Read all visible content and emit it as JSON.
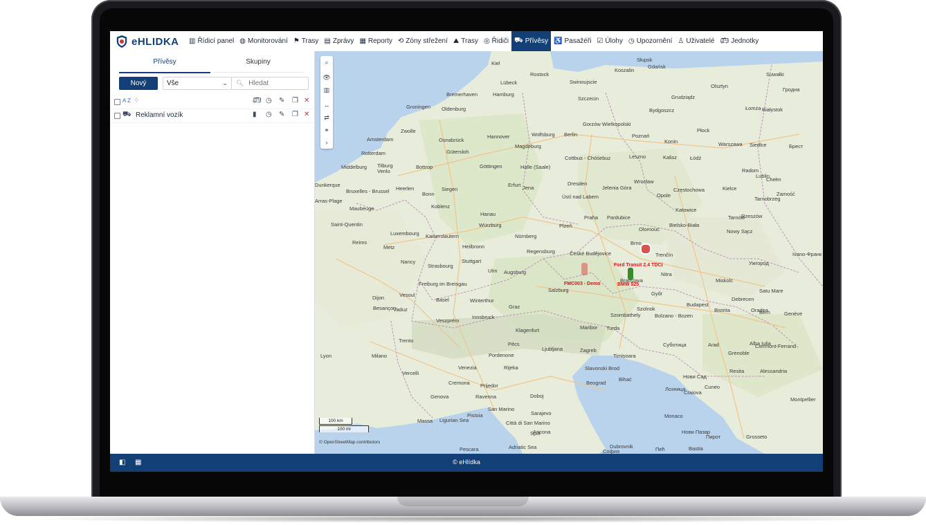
{
  "app": {
    "logo_text": "eHLIDKA",
    "footer_copyright": "© eHlídka"
  },
  "nav": [
    {
      "label": "Řídicí panel",
      "icon": "bar-chart-icon"
    },
    {
      "label": "Monitorování",
      "icon": "globe-icon"
    },
    {
      "label": "Trasy",
      "icon": "flag-icon"
    },
    {
      "label": "Zprávy",
      "icon": "message-icon"
    },
    {
      "label": "Reporty",
      "icon": "report-icon"
    },
    {
      "label": "Zóny střežení",
      "icon": "zone-icon"
    },
    {
      "label": "Trasy",
      "icon": "route-icon"
    },
    {
      "label": "Řidiči",
      "icon": "steering-wheel-icon"
    },
    {
      "label": "Přívěsy",
      "icon": "trailer-icon",
      "active": true
    },
    {
      "label": "Pasažéři",
      "icon": "passenger-icon"
    },
    {
      "label": "Úlohy",
      "icon": "task-icon"
    },
    {
      "label": "Upozornění",
      "icon": "alarm-icon"
    },
    {
      "label": "Uživatelé",
      "icon": "users-icon"
    },
    {
      "label": "Jednotky",
      "icon": "bus-icon"
    }
  ],
  "panel": {
    "tabs": [
      "Přívěsy",
      "Skupiny"
    ],
    "new_button": "Nový",
    "filter_value": "Vše",
    "search_placeholder": "Hledat",
    "sort_label": "A Z",
    "items": [
      {
        "name": "Reklamní vozík"
      }
    ]
  },
  "map": {
    "cities": [
      {
        "name": "Kiel"
      },
      {
        "name": "Rostock"
      },
      {
        "name": "Lübeck"
      },
      {
        "name": "Swinoujscie"
      },
      {
        "name": "Słupsk"
      },
      {
        "name": "Gdańsk"
      },
      {
        "name": "Koszalin"
      },
      {
        "name": "Bremerhaven"
      },
      {
        "name": "Hamburg"
      },
      {
        "name": "Szczecin"
      },
      {
        "name": "Suwałki"
      },
      {
        "name": "Olsztyn"
      },
      {
        "name": "Гродна"
      },
      {
        "name": "Groningen"
      },
      {
        "name": "Oldenburg"
      },
      {
        "name": "Grudziądz"
      },
      {
        "name": "Bydgoszcz"
      },
      {
        "name": "Łomża"
      },
      {
        "name": "Białystok"
      },
      {
        "name": "Berlin"
      },
      {
        "name": "Gorzów Wielkopolski"
      },
      {
        "name": "Zwolle"
      },
      {
        "name": "Osnabrück"
      },
      {
        "name": "Hannover"
      },
      {
        "name": "Wolfsburg"
      },
      {
        "name": "Poznań"
      },
      {
        "name": "Płock"
      },
      {
        "name": "Amsterdam"
      },
      {
        "name": "Magdeburg"
      },
      {
        "name": "Konin"
      },
      {
        "name": "Warszawa"
      },
      {
        "name": "Siedlce"
      },
      {
        "name": "Брест"
      },
      {
        "name": "Rotterdam"
      },
      {
        "name": "Gütersloh"
      },
      {
        "name": "Cottbus - Chóśebuz"
      },
      {
        "name": "Leszno"
      },
      {
        "name": "Kalisz"
      },
      {
        "name": "Łódź"
      },
      {
        "name": "Middelburg"
      },
      {
        "name": "Tilburg"
      },
      {
        "name": "Bottrop"
      },
      {
        "name": "Göttingen"
      },
      {
        "name": "Halle (Saale)"
      },
      {
        "name": "Radom"
      },
      {
        "name": "Venlo"
      },
      {
        "name": "Lublin"
      },
      {
        "name": "Chełm"
      },
      {
        "name": "Dunkerque"
      },
      {
        "name": "Heerlen"
      },
      {
        "name": "Erfurt"
      },
      {
        "name": "Dresden"
      },
      {
        "name": "Wrocław"
      },
      {
        "name": "Bruxelles - Brussel"
      },
      {
        "name": "Siegen"
      },
      {
        "name": "Jena"
      },
      {
        "name": "Jelenia Góra"
      },
      {
        "name": "Częstochowa"
      },
      {
        "name": "Kielce"
      },
      {
        "name": "Bonn"
      },
      {
        "name": "Ústí nad Labem"
      },
      {
        "name": "Opole"
      },
      {
        "name": "Tarnobrzeg"
      },
      {
        "name": "Zamość"
      },
      {
        "name": "Arras-Plage"
      },
      {
        "name": "Maubeuge"
      },
      {
        "name": "Koblenz"
      },
      {
        "name": "Katowice"
      },
      {
        "name": "Praha"
      },
      {
        "name": "Pardubice"
      },
      {
        "name": "Hanau"
      },
      {
        "name": "Tarnów"
      },
      {
        "name": "Rzeszów"
      },
      {
        "name": "Saint-Quentin"
      },
      {
        "name": "Würzburg"
      },
      {
        "name": "Plzeň"
      },
      {
        "name": "Olomouc"
      },
      {
        "name": "Bielsko-Biała"
      },
      {
        "name": "Luxembourg"
      },
      {
        "name": "Kaiserslautern"
      },
      {
        "name": "Nürnberg"
      },
      {
        "name": "Nowy Sącz"
      },
      {
        "name": "Reims"
      },
      {
        "name": "Metz"
      },
      {
        "name": "Heilbronn"
      },
      {
        "name": "Regensburg"
      },
      {
        "name": "České Budějovice"
      },
      {
        "name": "Brno"
      },
      {
        "name": "Trenčín"
      },
      {
        "name": "Nancy"
      },
      {
        "name": "Strasbourg"
      },
      {
        "name": "Stuttgart"
      },
      {
        "name": "Ivano-Франк"
      },
      {
        "name": "Ужгород"
      },
      {
        "name": "Ulm"
      },
      {
        "name": "Augsburg"
      },
      {
        "name": "Nitra"
      },
      {
        "name": "Freiburg im Breisgau"
      },
      {
        "name": "Salzburg"
      },
      {
        "name": "Bratislava"
      },
      {
        "name": "Miskolc"
      },
      {
        "name": "Satu Mare"
      },
      {
        "name": "Dijon"
      },
      {
        "name": "Vesoul"
      },
      {
        "name": "Basel"
      },
      {
        "name": "Winterthur"
      },
      {
        "name": "Győr"
      },
      {
        "name": "Budapest"
      },
      {
        "name": "Debrecen"
      },
      {
        "name": "Oradea"
      },
      {
        "name": "Besançon"
      },
      {
        "name": "Vaduz"
      },
      {
        "name": "Innsbruck"
      },
      {
        "name": "Graz"
      },
      {
        "name": "Szombathely"
      },
      {
        "name": "Szolnok"
      },
      {
        "name": "Bistrita"
      },
      {
        "name": "Bern"
      },
      {
        "name": "Veszprém"
      },
      {
        "name": "Bolzano - Bozen"
      },
      {
        "name": "Klagenfurt"
      },
      {
        "name": "Maribor"
      },
      {
        "name": "Turda"
      },
      {
        "name": "Genève"
      },
      {
        "name": "Trento"
      },
      {
        "name": "Pécs"
      },
      {
        "name": "Суботица"
      },
      {
        "name": "Arad"
      },
      {
        "name": "Alba Iulia"
      },
      {
        "name": "Clermont-Ferrand"
      },
      {
        "name": "Lyon"
      },
      {
        "name": "Milano"
      },
      {
        "name": "Pordenone"
      },
      {
        "name": "Ljubljana"
      },
      {
        "name": "Zagreb"
      },
      {
        "name": "Timișoara"
      },
      {
        "name": "Grenoble"
      },
      {
        "name": "Vercelli"
      },
      {
        "name": "Venezia"
      },
      {
        "name": "Rijeka"
      },
      {
        "name": "Slavonski Brod"
      },
      {
        "name": "Нови Сад"
      },
      {
        "name": "Resita"
      },
      {
        "name": "Alessandria"
      },
      {
        "name": "Cremona"
      },
      {
        "name": "Prijedor"
      },
      {
        "name": "Bihać"
      },
      {
        "name": "Beograd"
      },
      {
        "name": "Cuneo"
      },
      {
        "name": "Genova"
      },
      {
        "name": "Ravenna"
      },
      {
        "name": "Doboj"
      },
      {
        "name": "Лозница"
      },
      {
        "name": "Craiova"
      },
      {
        "name": "Montpellier"
      },
      {
        "name": "Massa"
      },
      {
        "name": "San Marino"
      },
      {
        "name": "Sarajevo"
      },
      {
        "name": "Monaco"
      },
      {
        "name": "Ligurian Sea"
      },
      {
        "name": "Pistoia"
      },
      {
        "name": "Città di San Marino"
      },
      {
        "name": "Ancona"
      },
      {
        "name": "Split"
      },
      {
        "name": "Нови Пазар"
      },
      {
        "name": "Пирот"
      },
      {
        "name": "Grosseto"
      },
      {
        "name": "Adriatic Sea"
      },
      {
        "name": "Dubrovnik"
      },
      {
        "name": "Пећ"
      },
      {
        "name": "Bastia"
      },
      {
        "name": "Pescara"
      },
      {
        "name": "София"
      }
    ],
    "markers": [
      {
        "label": "FMC003 - Demo",
        "color": "#d9534f"
      },
      {
        "label": "BMW 525",
        "color": "#3a8a2e"
      },
      {
        "label": "Ford Transit 2.4 TDCi",
        "color": "#d9534f"
      }
    ],
    "scale_km": "100 km",
    "scale_mi": "100 mi",
    "attribution": "© OpenStreetMap contributors",
    "water_color": "#b7d3ee",
    "land_color": "#e7ecdc"
  },
  "theme": {
    "brand_color": "#123f75",
    "danger_color": "#d23434"
  }
}
